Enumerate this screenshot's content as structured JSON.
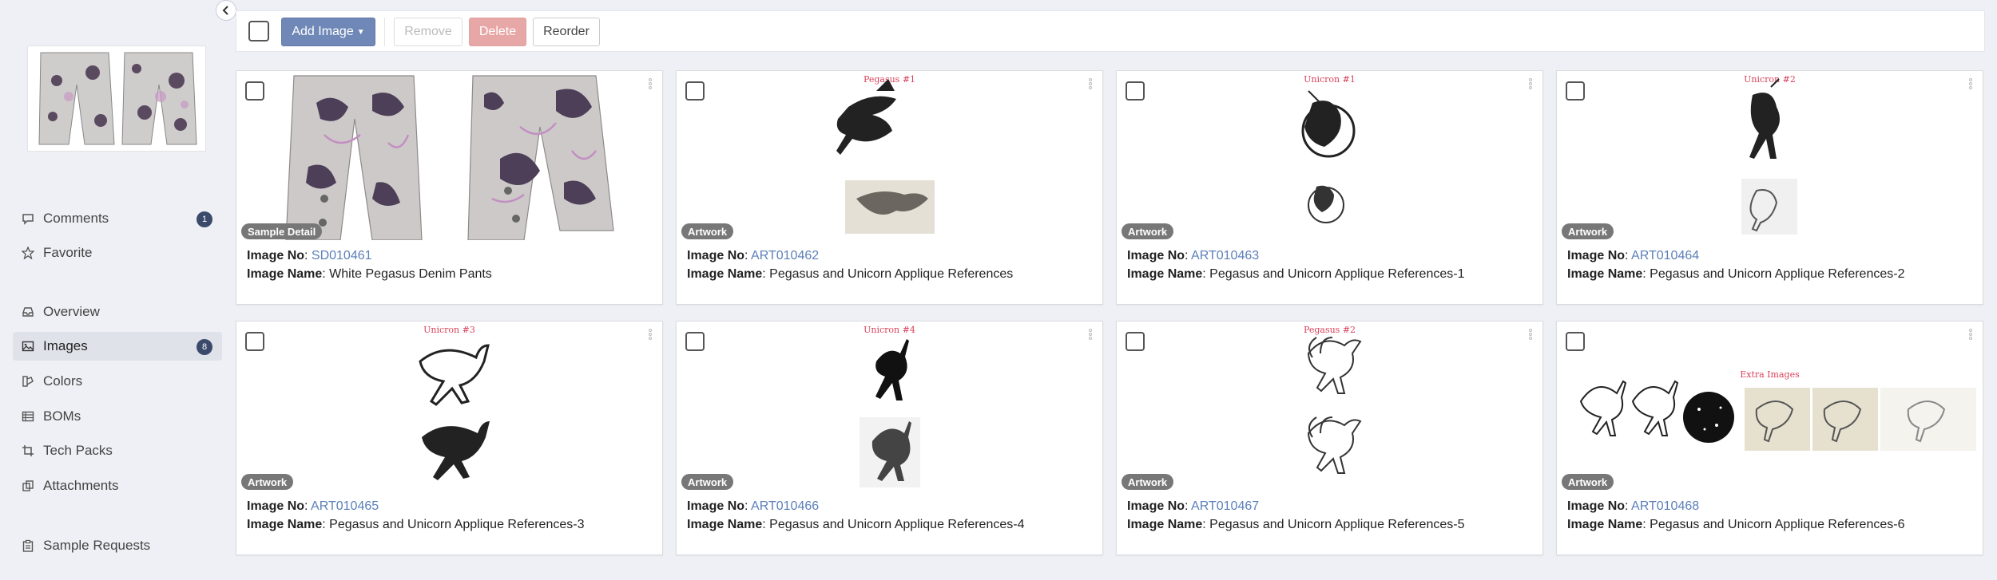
{
  "sidebar": {
    "items": [
      {
        "label": "Comments",
        "badge": "1"
      },
      {
        "label": "Favorite"
      },
      {
        "label": "Overview"
      },
      {
        "label": "Images",
        "badge": "8"
      },
      {
        "label": "Colors"
      },
      {
        "label": "BOMs"
      },
      {
        "label": "Tech Packs"
      },
      {
        "label": "Attachments"
      },
      {
        "label": "Sample Requests"
      }
    ]
  },
  "toolbar": {
    "add_label": "Add Image",
    "remove_label": "Remove",
    "delete_label": "Delete",
    "reorder_label": "Reorder"
  },
  "labels": {
    "image_no": "Image No",
    "image_name": "Image Name"
  },
  "cards": [
    {
      "type": "Sample Detail",
      "media_title": "",
      "no": "SD010461",
      "name": "White Pegasus Denim Pants"
    },
    {
      "type": "Artwork",
      "media_title": "Pegasus #1",
      "no": "ART010462",
      "name": "Pegasus and Unicorn Applique References"
    },
    {
      "type": "Artwork",
      "media_title": "Unicron #1",
      "no": "ART010463",
      "name": "Pegasus and Unicorn Applique References-1"
    },
    {
      "type": "Artwork",
      "media_title": "Unicron #2",
      "no": "ART010464",
      "name": "Pegasus and Unicorn Applique References-2"
    },
    {
      "type": "Artwork",
      "media_title": "Unicron #3",
      "no": "ART010465",
      "name": "Pegasus and Unicorn Applique References-3"
    },
    {
      "type": "Artwork",
      "media_title": "Unicron #4",
      "no": "ART010466",
      "name": "Pegasus and Unicorn Applique References-4"
    },
    {
      "type": "Artwork",
      "media_title": "Pegasus #2",
      "no": "ART010467",
      "name": "Pegasus and Unicorn Applique References-5"
    },
    {
      "type": "Artwork",
      "media_title": "Extra Images",
      "no": "ART010468",
      "name": "Pegasus and Unicorn Applique References-6"
    }
  ],
  "colors": {
    "accent": "#7088b7",
    "link": "#5b7fb8",
    "delete": "#e8a7a7",
    "artwork_title": "#d9415a",
    "badge": "#3b4a6b"
  }
}
